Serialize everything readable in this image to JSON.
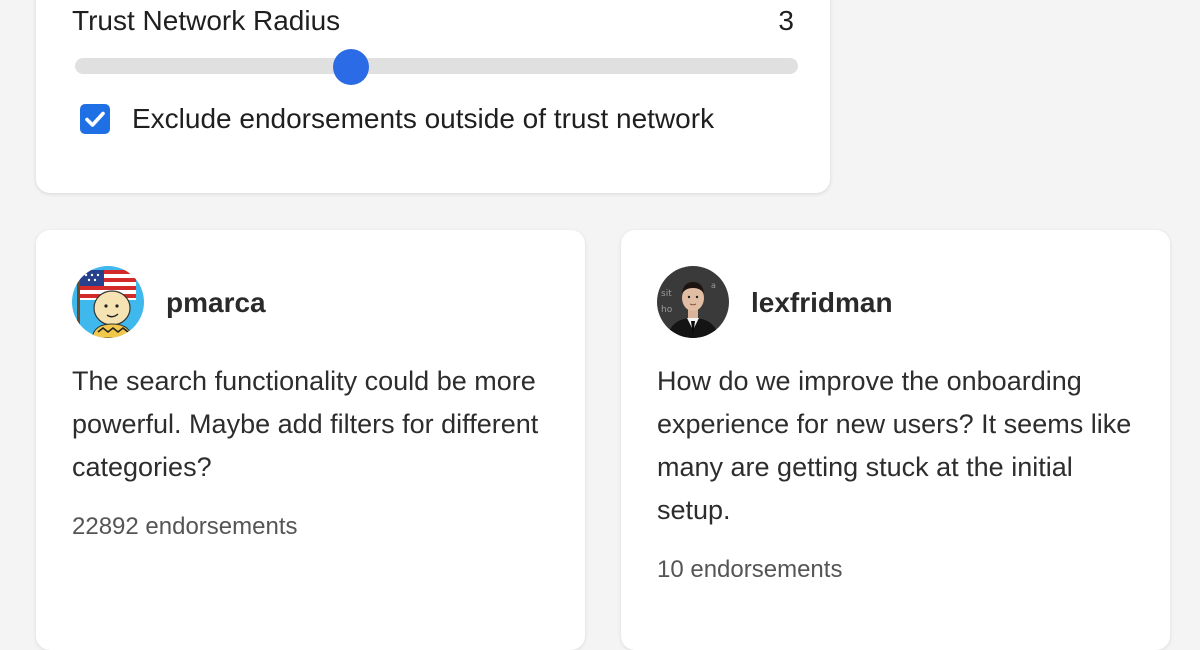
{
  "settings": {
    "radius_label": "Trust Network Radius",
    "radius_value": "3",
    "slider": {
      "min": 0,
      "max": 8,
      "value": 3
    },
    "exclude_label": "Exclude endorsements outside of trust network",
    "exclude_checked": true,
    "accent_color": "#2b6be6"
  },
  "posts": [
    {
      "username": "pmarca",
      "avatar": "cartoon-flag-avatar",
      "text": "The search functionality could be more powerful. Maybe add filters for different categories?",
      "endorsements": "22892 endorsements"
    },
    {
      "username": "lexfridman",
      "avatar": "person-photo-avatar",
      "text": "How do we improve the onboarding experience for new users? It seems like many are getting stuck at the initial setup.",
      "endorsements": "10 endorsements"
    }
  ]
}
